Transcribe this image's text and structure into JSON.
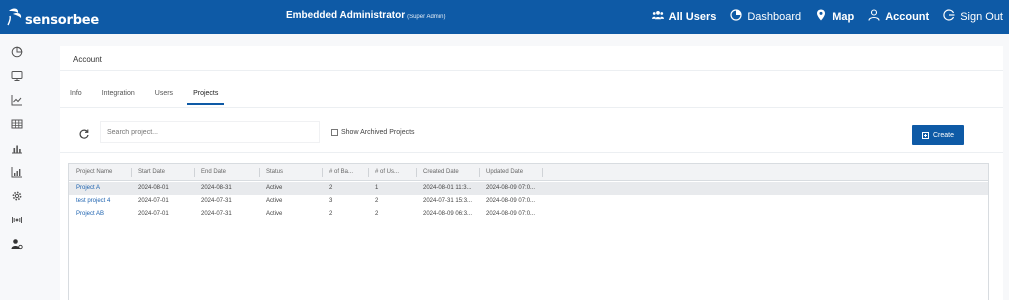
{
  "brand": {
    "name": "sensorbee"
  },
  "header": {
    "user_title": "Embedded Administrator",
    "user_role": "(Super Admin)",
    "nav": [
      {
        "label": "All Users",
        "icon": "users-icon"
      },
      {
        "label": "Dashboard",
        "icon": "dashboard-icon"
      },
      {
        "label": "Map",
        "icon": "map-pin-icon"
      },
      {
        "label": "Account",
        "icon": "person-icon"
      },
      {
        "label": "Sign Out",
        "icon": "sign-out-icon"
      }
    ]
  },
  "sidebar": {
    "items": [
      {
        "icon": "gauge-icon"
      },
      {
        "icon": "monitor-icon"
      },
      {
        "icon": "line-chart-icon"
      },
      {
        "icon": "grid-table-icon"
      },
      {
        "icon": "bar-chart-icon"
      },
      {
        "icon": "analytics-icon"
      },
      {
        "icon": "gear-icon"
      },
      {
        "icon": "sensor-signal-icon"
      },
      {
        "icon": "user-settings-icon"
      }
    ]
  },
  "page": {
    "breadcrumb": "Account",
    "tabs": [
      {
        "label": "Info",
        "active": false
      },
      {
        "label": "Integration",
        "active": false
      },
      {
        "label": "Users",
        "active": false
      },
      {
        "label": "Projects",
        "active": true
      }
    ]
  },
  "toolbar": {
    "search_placeholder": "Search project...",
    "show_archived_label": "Show Archived Projects",
    "create_label": "Create"
  },
  "table": {
    "columns": [
      "Project Name",
      "Start Date",
      "End Date",
      "Status",
      "# of Ba...",
      "# of Us...",
      "Created Date",
      "Updated Date"
    ],
    "rows": [
      [
        "Project A",
        "2024-08-01",
        "2024-08-31",
        "Active",
        "2",
        "1",
        "2024-08-01 11:3...",
        "2024-08-09 07:0..."
      ],
      [
        "test project 4",
        "2024-07-01",
        "2024-07-31",
        "Active",
        "3",
        "2",
        "2024-07-31 15:3...",
        "2024-08-09 07:0..."
      ],
      [
        "Project AB",
        "2024-07-01",
        "2024-07-31",
        "Active",
        "2",
        "2",
        "2024-08-09 06:3...",
        "2024-08-09 07:0..."
      ]
    ]
  },
  "colors": {
    "primary": "#0e5aa6",
    "link": "#1e63b0",
    "selected_row": "#e8eaed"
  }
}
